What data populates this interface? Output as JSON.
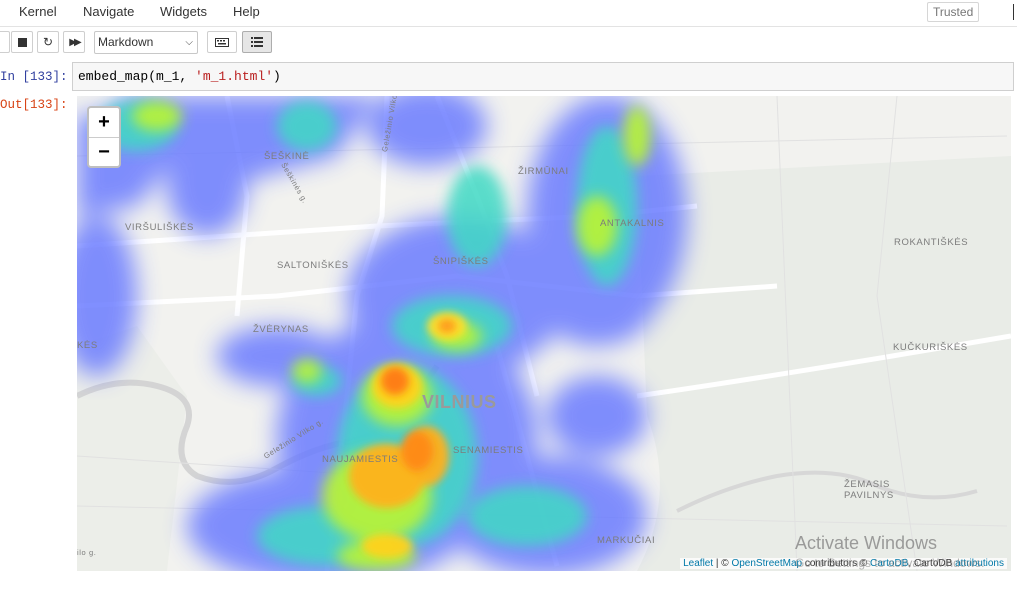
{
  "menubar": {
    "items": [
      "Kernel",
      "Navigate",
      "Widgets",
      "Help"
    ],
    "trusted_label": "Trusted"
  },
  "toolbar": {
    "cell_type": "Markdown",
    "icons": [
      "stop-icon",
      "restart-icon",
      "fast-forward-icon",
      "keyboard-icon",
      "list-icon"
    ]
  },
  "cell_in": {
    "prompt": "In [133]:",
    "code_prefix": "embed_map(m_1, ",
    "code_string": "'m_1.html'",
    "code_suffix": ")"
  },
  "cell_out": {
    "prompt": "Out[133]:"
  },
  "map": {
    "zoom_in": "+",
    "zoom_out": "−",
    "places": {
      "seskine": "ŠEŠKINĖ",
      "zirmunai": "ŽIRMŪNAI",
      "virsuliskes": "VIRŠULIŠKĖS",
      "antakalnis": "ANTAKALNIS",
      "rokantiskes": "ROKANTIŠKĖS",
      "saltoniskes": "SALTONIŠKĖS",
      "snipiskes": "ŠNIPIŠKĖS",
      "zverynas": "ŽVĖRYNAS",
      "kes": "KĖS",
      "kucukiskes": "KUČKURIŠKĖS",
      "vilnius": "VILNIUS",
      "senamiestis": "SENAMIESTIS",
      "naujamiestis": "NAUJAMIESTIS",
      "zemasis": "ŽEMASIS",
      "pavilnys": "PAVILNYS",
      "markuciai": "MARKUČIAI",
      "street_gelezinio": "Geležinio Vilko g.",
      "street_gelezinio2": "Geležinio Vilko g.",
      "street_seskines": "Šeškinės g.",
      "street_g": "ilo g."
    },
    "attribution": {
      "leaflet": "Leaflet",
      "sep": " | © ",
      "osm": "OpenStreetMap",
      "contrib": " contributors © ",
      "cartodb": "CartoDB",
      "mid": ", CartoDB ",
      "attr": "attributions"
    }
  },
  "overlay": {
    "activate_title": "Activate Windows",
    "activate_sub": "Go to Settings to activate Windows."
  }
}
